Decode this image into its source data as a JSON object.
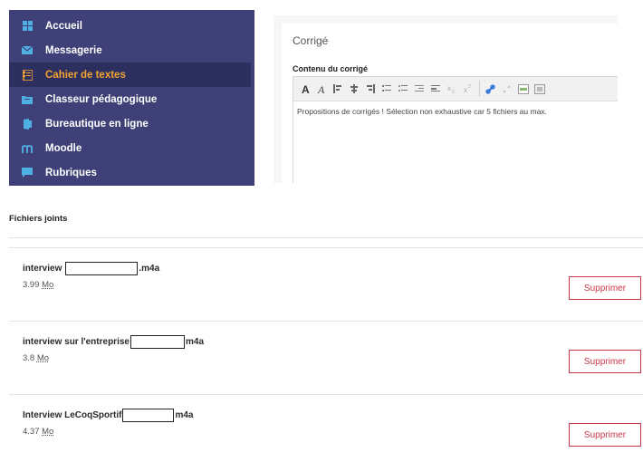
{
  "colors": {
    "sidebar_bg": "#3e4077",
    "sidebar_active_bg": "#2d2f5f",
    "active_text": "#f3a431",
    "delete_red": "#c93746"
  },
  "sidebar": {
    "items": [
      {
        "label": "Accueil",
        "icon": "grid-icon"
      },
      {
        "label": "Messagerie",
        "icon": "envelope-icon"
      },
      {
        "label": "Cahier de textes",
        "icon": "notebook-icon",
        "active": true
      },
      {
        "label": "Classeur pédagogique",
        "icon": "folder-icon"
      },
      {
        "label": "Bureautique en ligne",
        "icon": "document-icon"
      },
      {
        "label": "Moodle",
        "icon": "moodle-icon"
      },
      {
        "label": "Rubriques",
        "icon": "comment-icon"
      }
    ]
  },
  "editor": {
    "title": "Corrigé",
    "content_label": "Contenu du corrigé",
    "toolbar": [
      "bold",
      "italic",
      "align-left",
      "align-center",
      "align-right",
      "ordered-list",
      "unordered-list",
      "outdent",
      "indent",
      "subscript",
      "superscript",
      "link",
      "unlink",
      "source",
      "table"
    ],
    "text": "Propositions de corrigés ! Sélection non exhaustive car 5 fichiers au max."
  },
  "attachments": {
    "title": "Fichiers joints",
    "delete_label": "Supprimer",
    "files": [
      {
        "name_prefix": "interview",
        "name_suffix": ".m4a",
        "size_value": "3.99",
        "size_unit": "Mo"
      },
      {
        "name_prefix": "interview sur l'entreprise",
        "name_suffix": "m4a",
        "size_value": "3.8",
        "size_unit": "Mo"
      },
      {
        "name_prefix": "Interview LeCoqSportif",
        "name_suffix": "m4a",
        "size_value": "4.37",
        "size_unit": "Mo"
      }
    ]
  }
}
